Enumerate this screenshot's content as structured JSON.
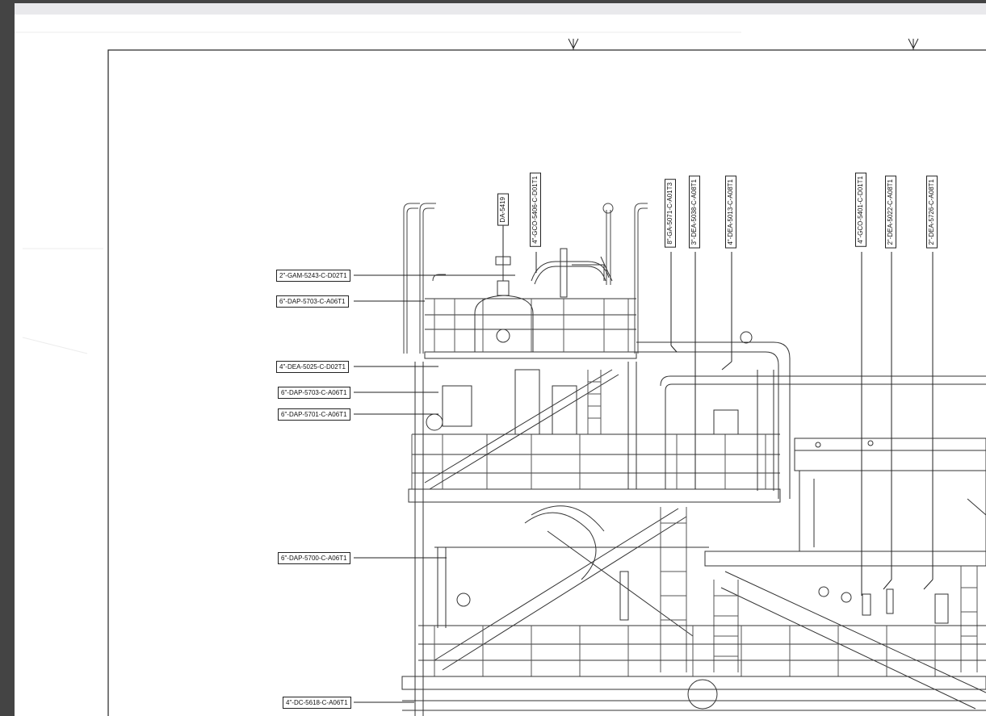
{
  "horizontal_line_labels": [
    "2\"-GAM-5243-C-D02T1",
    "6\"-DAP-5703-C-A06T1",
    "4\"-DEA-5025-C-D02T1",
    "6\"-DAP-5703-C-A06T1",
    "6\"-DAP-5701-C-A06T1",
    "6\"-DAP-5700-C-A06T1",
    "4\"-DC-5618-C-A06T1"
  ],
  "vertical_line_labels": [
    "DA-5419",
    "4\"-GCO-5406-C-D01T1",
    "8\"-GA-5071-C-A01T3",
    "3\"-DEA-5038-C-A08T1",
    "4\"-DEA-5013-C-A08T1",
    "4\"-GCO-5401-C-D01T1",
    "2\"-DEA-5022-C-A08T1",
    "2\"-DEA-5726-C-A08T1"
  ]
}
